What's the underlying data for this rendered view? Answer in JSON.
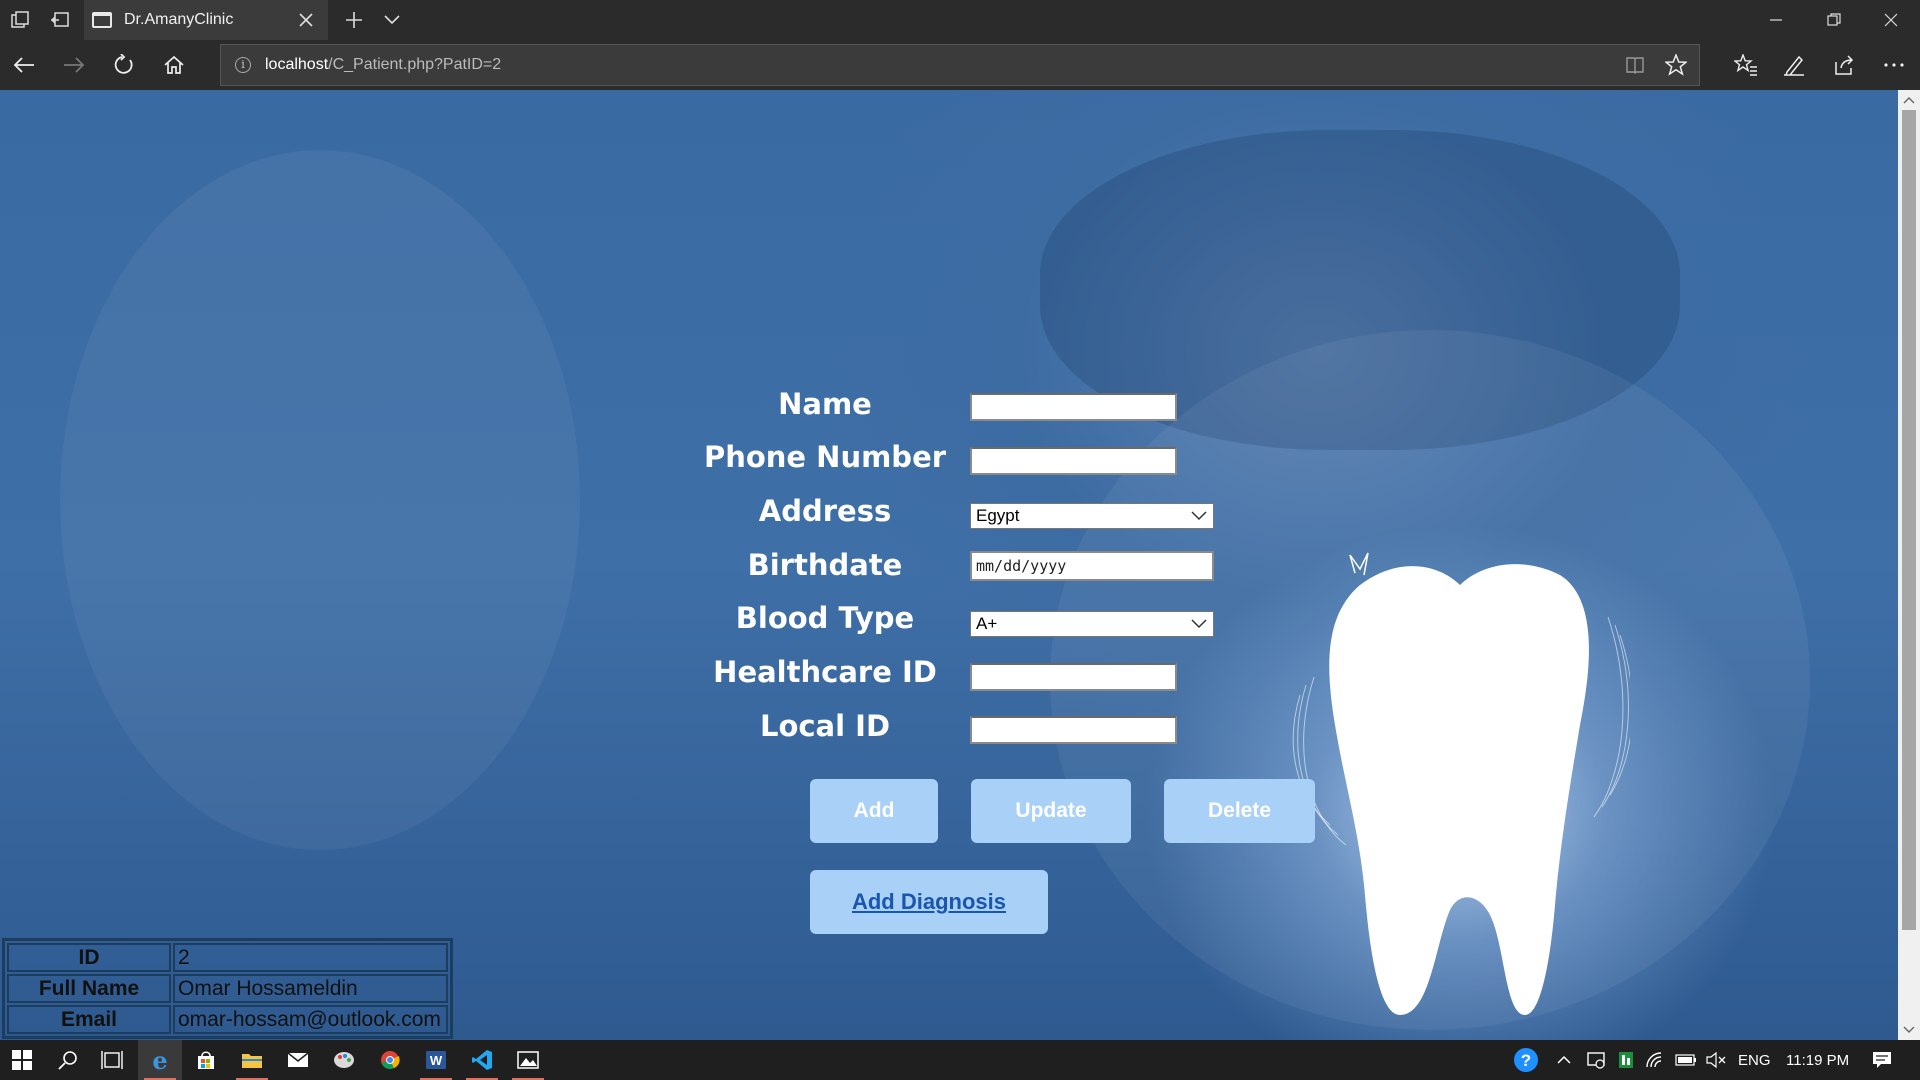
{
  "browser": {
    "tab_title": "Dr.AmanyClinic",
    "url_host": "localhost",
    "url_path": "/C_Patient.php?PatID=2"
  },
  "form": {
    "labels": {
      "name": "Name",
      "phone": "Phone Number",
      "address": "Address",
      "birthdate": "Birthdate",
      "blood_type": "Blood Type",
      "healthcare_id": "Healthcare ID",
      "local_id": "Local ID"
    },
    "values": {
      "name": "",
      "phone": "",
      "address": "Egypt",
      "birthdate_placeholder": "mm/dd/yyyy",
      "blood_type": "A+",
      "healthcare_id": "",
      "local_id": ""
    },
    "buttons": {
      "add": "Add",
      "update": "Update",
      "delete": "Delete",
      "add_diagnosis": "Add Diagnosis"
    }
  },
  "patient_table": [
    {
      "key": "ID",
      "value": "2"
    },
    {
      "key": "Full Name",
      "value": "Omar Hossameldin"
    },
    {
      "key": "Email",
      "value": "omar-hossam@outlook.com"
    }
  ],
  "taskbar": {
    "language": "ENG",
    "time": "11:19 PM",
    "icons": [
      "windows-start-icon",
      "search-icon",
      "task-view-icon",
      "edge-icon",
      "store-icon",
      "file-explorer-icon",
      "mail-icon",
      "paint-icon",
      "chrome-icon",
      "word-icon",
      "vscode-icon",
      "photos-icon"
    ]
  },
  "colors": {
    "page_bg": "#3d6ca3",
    "button_bg": "#a9d1f7",
    "link": "#1a56b0"
  }
}
